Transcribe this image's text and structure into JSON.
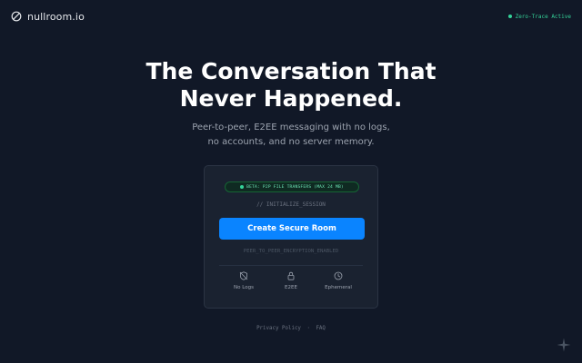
{
  "header": {
    "brand_name": "nullroom.io",
    "status_text": "Zero-Trace Active"
  },
  "hero": {
    "title": "The Conversation That Never Happened.",
    "subtitle": "Peer-to-peer, E2EE messaging with no logs, no accounts, and no server memory."
  },
  "card": {
    "beta_badge": "BETA: P2P FILE TRANSFERS (MAX 24 MB)",
    "init_label": "// INITIALIZE_SESSION",
    "create_button": "Create Secure Room",
    "encryption_label": "PEER_TO_PEER_ENCRYPTION_ENABLED",
    "features": [
      {
        "label": "No Logs",
        "icon": "shield-off-icon"
      },
      {
        "label": "E2EE",
        "icon": "lock-icon"
      },
      {
        "label": "Ephemeral",
        "icon": "clock-icon"
      }
    ]
  },
  "footer": {
    "privacy_link": "Privacy Policy",
    "separator": "·",
    "faq_link": "FAQ"
  },
  "colors": {
    "background": "#111827",
    "card": "#1a2230",
    "accent": "#0a84ff",
    "status_green": "#34d399"
  }
}
